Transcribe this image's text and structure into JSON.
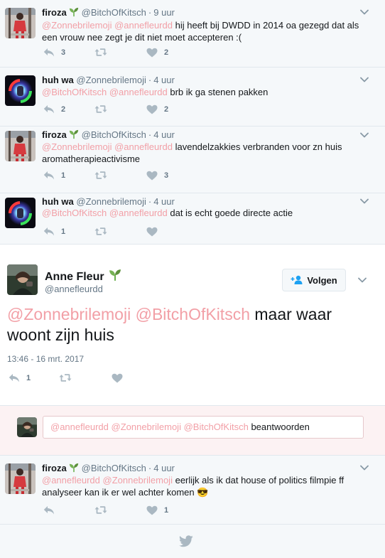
{
  "colors": {
    "mention": "#f29fa6",
    "meta": "#657786",
    "icon": "#aab8c2",
    "follow_icon": "#1da1f2"
  },
  "tweets": [
    {
      "name": "firoza",
      "handle": "@BitchOfKitsch",
      "time": "9 uur",
      "mentions": [
        "@Zonnebrilemoji",
        "@annefleurdd"
      ],
      "text": "hij heeft bij DWDD in 2014 oa gezegd dat als een vrouw nee zegt je dit niet moet accepteren :(",
      "reply_count": "3",
      "retweet_count": "",
      "like_count": "2"
    },
    {
      "name": "huh wa",
      "handle": "@Zonnebrilemoji",
      "time": "4 uur",
      "mentions": [
        "@BitchOfKitsch",
        "@annefleurdd"
      ],
      "text": "brb ik ga stenen pakken",
      "reply_count": "2",
      "retweet_count": "",
      "like_count": "2"
    },
    {
      "name": "firoza",
      "handle": "@BitchOfKitsch",
      "time": "4 uur",
      "mentions": [
        "@Zonnebrilemoji",
        "@annefleurdd"
      ],
      "text": "lavendelzakkies verbranden voor zn huis aromatherapieactivisme",
      "reply_count": "1",
      "retweet_count": "",
      "like_count": "3"
    },
    {
      "name": "huh wa",
      "handle": "@Zonnebrilemoji",
      "time": "4 uur",
      "mentions": [
        "@BitchOfKitsch",
        "@annefleurdd"
      ],
      "text": "dat is echt goede directe actie",
      "reply_count": "1",
      "retweet_count": "",
      "like_count": ""
    }
  ],
  "focused": {
    "name": "Anne Fleur",
    "handle": "@annefleurdd",
    "follow_label": "Volgen",
    "mentions": [
      "@Zonnebrilemoji",
      "@BitchOfKitsch"
    ],
    "text": "maar waar woont zijn huis",
    "timestamp": "13:46 - 16 mrt. 2017",
    "reply_count": "1",
    "retweet_count": "",
    "like_count": ""
  },
  "reply_box": {
    "mentions": [
      "@annefleurdd",
      "@Zonnebrilemoji",
      "@BitchOfKitsch"
    ],
    "label": "beantwoorden"
  },
  "last_tweet": {
    "name": "firoza",
    "handle": "@BitchOfKitsch",
    "time": "4 uur",
    "mentions": [
      "@annefleurdd",
      "@Zonnebrilemoji"
    ],
    "text": "eerlijk als ik dat house of politics filmpie ff analyseer kan ik er wel achter komen",
    "emoji": "😎",
    "reply_count": "",
    "retweet_count": "",
    "like_count": "1"
  }
}
